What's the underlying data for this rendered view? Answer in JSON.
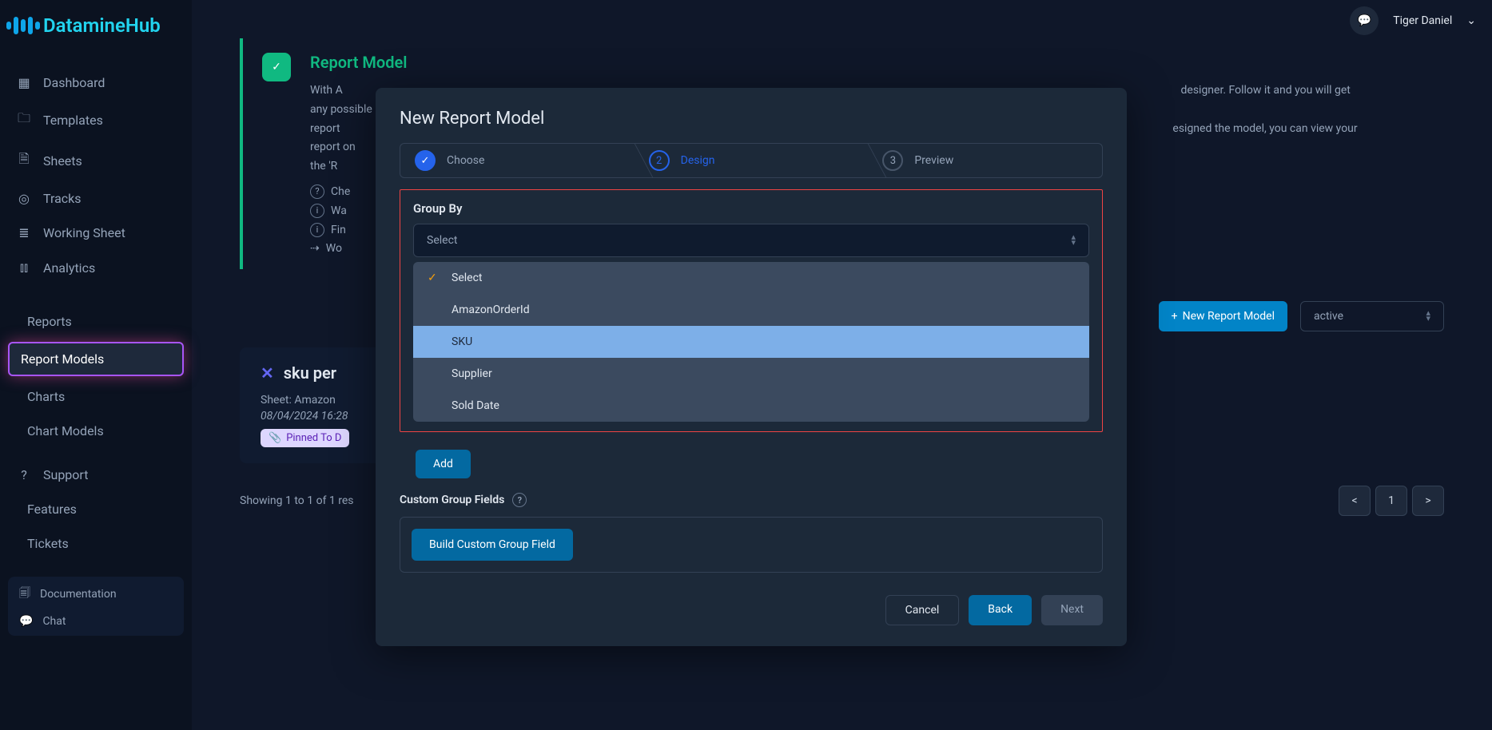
{
  "brand": "DatamineHub",
  "user_name": "Tiger Daniel",
  "sidebar": {
    "items": [
      {
        "label": "Dashboard",
        "icon": "grid"
      },
      {
        "label": "Templates",
        "icon": "folder"
      },
      {
        "label": "Sheets",
        "icon": "file"
      },
      {
        "label": "Tracks",
        "icon": "target"
      },
      {
        "label": "Working Sheet",
        "icon": "list"
      },
      {
        "label": "Analytics",
        "icon": "chart"
      }
    ],
    "sub_items": [
      {
        "label": "Reports"
      },
      {
        "label": "Report Models"
      },
      {
        "label": "Charts"
      },
      {
        "label": "Chart Models"
      }
    ],
    "support_label": "Support",
    "features_label": "Features",
    "tickets_label": "Tickets",
    "doc_label": "Documentation",
    "chat_label": "Chat"
  },
  "info": {
    "title": "Report Model",
    "desc_prefix": "With A",
    "desc_visible_end": "designer. Follow it and you will get any possible",
    "desc_line2_prefix": "report",
    "desc_line2_end": "esigned the model, you can view your report on",
    "desc_line3": "the 'R",
    "bullets": [
      "Che",
      "Wa",
      "Fin",
      "Wo"
    ]
  },
  "actions": {
    "new_model": "New Report Model",
    "status_filter": "active"
  },
  "card": {
    "title_visible": "sku per",
    "sheet_line": "Sheet: Amazon",
    "timestamp": "08/04/2024 16:28",
    "pinned": "Pinned To D"
  },
  "footer": {
    "showing": "Showing 1 to 1 of 1 res",
    "page": "1",
    "prev": "<",
    "next": ">"
  },
  "modal": {
    "title": "New Report Model",
    "steps": [
      {
        "num": "",
        "label": "Choose",
        "state": "done"
      },
      {
        "num": "2",
        "label": "Design",
        "state": "active"
      },
      {
        "num": "3",
        "label": "Preview",
        "state": "pending"
      }
    ],
    "group_by_label": "Group By",
    "select_placeholder": "Select",
    "options": [
      {
        "label": "Select",
        "checked": true
      },
      {
        "label": "AmazonOrderId"
      },
      {
        "label": "SKU",
        "highlight": true
      },
      {
        "label": "Supplier"
      },
      {
        "label": "Sold Date"
      }
    ],
    "add_btn": "Add",
    "custom_label": "Custom Group Fields",
    "build_btn": "Build Custom Group Field",
    "cancel": "Cancel",
    "back": "Back",
    "next": "Next"
  }
}
